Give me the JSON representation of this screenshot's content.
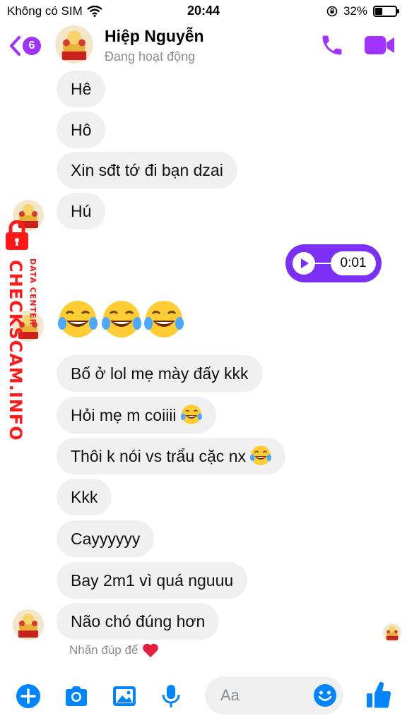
{
  "status_bar": {
    "carrier": "Không có SIM",
    "time": "20:44",
    "battery_percent": "32%",
    "battery_level": 0.32
  },
  "header": {
    "back_count": "6",
    "contact_name": "Hiệp Nguyễn",
    "contact_status": "Đang hoạt động"
  },
  "messages": [
    "Hê",
    "Hô",
    "Xin sđt tớ đi bạn dzai",
    "Hú",
    "Bố ở lol mẹ mày đấy kkk",
    "Hỏi mẹ m coiiii",
    "Thôi k nói vs trẩu cặc nx",
    "Kkk",
    "Cayyyyyy",
    "Bay 2m1 vì quá nguuu",
    "Não chó đúng hơn"
  ],
  "voice_message": {
    "duration": "0:01"
  },
  "hint": {
    "text": "Nhấn đúp để"
  },
  "composer": {
    "placeholder": "Aa"
  },
  "watermark": {
    "main": "CHECKSCAM.INFO",
    "sub": "DATA CENTER"
  },
  "colors": {
    "accent": "#a033ff",
    "voice_bubble": "#7b2ff7",
    "bubble": "#f0f0f0",
    "muted": "#8a8d91",
    "watermark": "#ff1a1a"
  },
  "icons": [
    "wifi-icon",
    "lock-rotation-icon",
    "back-chevron-icon",
    "phone-icon",
    "video-icon",
    "play-icon",
    "laugh-cry-emoji",
    "heart-icon",
    "plus-icon",
    "camera-icon",
    "gallery-icon",
    "mic-icon",
    "smile-icon",
    "thumbs-up-icon"
  ]
}
